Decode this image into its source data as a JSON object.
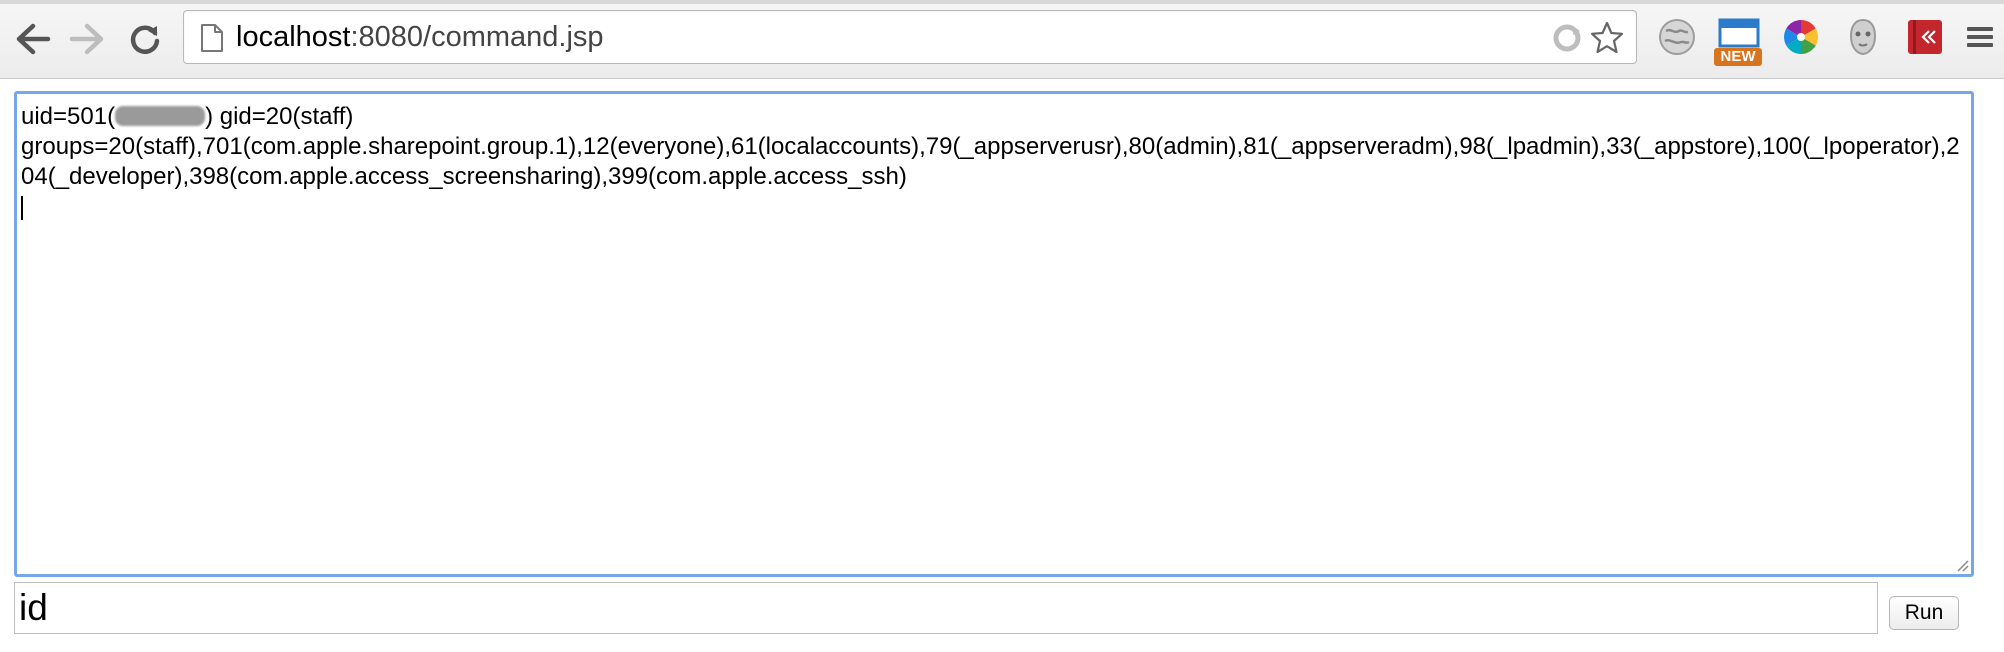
{
  "browser": {
    "address": {
      "host": "localhost",
      "rest": ":8080/command.jsp"
    },
    "extensions": [
      {
        "name": "globe-icon"
      },
      {
        "name": "new-tab-extension-icon",
        "badge": "NEW"
      },
      {
        "name": "color-wheel-icon"
      },
      {
        "name": "ghost-icon"
      },
      {
        "name": "red-book-extension-icon"
      }
    ]
  },
  "output": {
    "line1_prefix": "uid=501(",
    "line1_suffix": ") gid=20(staff)",
    "line2": "groups=20(staff),701(com.apple.sharepoint.group.1),12(everyone),61(localaccounts),79(_appserverusr),80(admin),81(_appserveradm),98(_lpadmin),33(_appstore),100(_lpoperator),204(_developer),398(com.apple.access_screensharing),399(com.apple.access_ssh)"
  },
  "command": {
    "value": "id"
  },
  "run_button": {
    "label": "Run"
  },
  "colors": {
    "focus_ring": "#76a7e8",
    "new_badge": "#d8741d",
    "red_extension": "#c4262e"
  }
}
